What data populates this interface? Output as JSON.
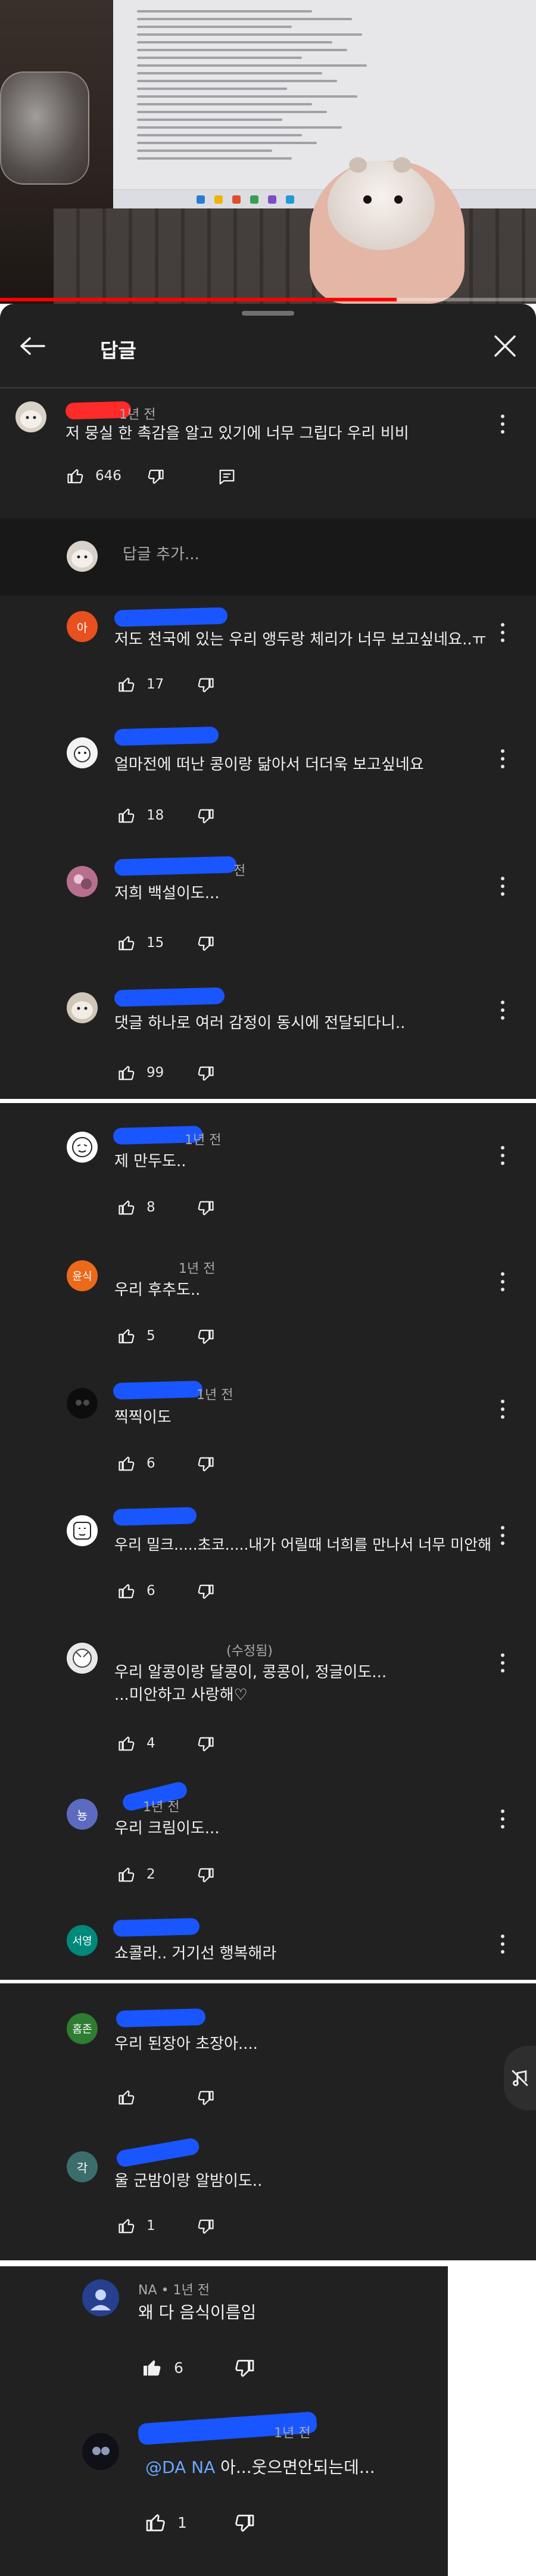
{
  "video": {
    "progress": 0.74
  },
  "sheet": {
    "title": "답글",
    "add_reply_placeholder": "답글 추가..."
  },
  "main_comment": {
    "meta": "1년 전",
    "text": "저 뭉실 한 촉감을 알고 있기에 너무 그립다 우리 비비",
    "likes": "646"
  },
  "replies": [
    {
      "avatar_letter": "아",
      "avatar_color": "#e8501f",
      "meta": "",
      "text": "저도 천국에 있는 우리 앵두랑 체리가 너무 보고싶네요..ㅠ",
      "likes": "17"
    },
    {
      "avatar_letter": "",
      "avatar_color": "#f3f3f3",
      "meta": "",
      "text": "얼마전에 떠난 콩이랑 닮아서 더더욱 보고싶네요",
      "likes": "18"
    },
    {
      "avatar_letter": "",
      "avatar_color": "#c98aa3",
      "meta": "전",
      "text": "저희 백설이도...",
      "likes": "15"
    },
    {
      "avatar_letter": "",
      "avatar_color": "#cfc6b8",
      "meta": "",
      "text": "댓글 하나로 여러 감정이 동시에 전달되다니..",
      "likes": "99"
    }
  ],
  "replies2": [
    {
      "avatar_letter": "",
      "avatar_color": "#ffffff",
      "meta": "1년 전",
      "lines": [
        "제 만두도.."
      ],
      "likes": "8"
    },
    {
      "avatar_letter": "윤식",
      "avatar_color": "#ea6a1a",
      "meta": "1년 전",
      "lines": [
        "우리 후추도.."
      ],
      "likes": "5"
    },
    {
      "avatar_letter": "",
      "avatar_color": "#111111",
      "meta": "1년 전",
      "lines": [
        "찍찍이도"
      ],
      "likes": "6"
    },
    {
      "avatar_letter": "",
      "avatar_color": "#ffffff",
      "meta": "",
      "lines": [
        "우리 밀크.....초코.....내가 어릴때 너희를 만나서 너무 미안해"
      ],
      "likes": "6"
    },
    {
      "avatar_letter": "",
      "avatar_color": "#e9e9e9",
      "meta": "(수정됨)",
      "lines": [
        "우리 알콩이랑 달콩이, 콩콩이, 정글이도...",
        "...미안하고 사랑해♡"
      ],
      "likes": "4"
    },
    {
      "avatar_letter": "뇽",
      "avatar_color": "#5c6bc0",
      "meta": "1년 전",
      "lines": [
        "우리 크림이도..."
      ],
      "likes": "2"
    },
    {
      "avatar_letter": "서영",
      "avatar_color": "#00897b",
      "meta": "",
      "lines": [
        "쇼콜라.. 거기선 행복해라"
      ],
      "likes": ""
    }
  ],
  "replies3": [
    {
      "avatar_letter": "홈존",
      "avatar_color": "#2e7d32",
      "meta": "",
      "text": "우리 된장아  초장아....",
      "likes": ""
    },
    {
      "avatar_letter": "각",
      "avatar_color": "#3b6e6a",
      "meta": "",
      "text": "울 군밤이랑 알밤이도..",
      "likes": "1"
    }
  ],
  "replies4": [
    {
      "meta": "NA • 1년 전",
      "mention": "",
      "text": "왜 다 음식이름임",
      "likes": "6"
    },
    {
      "meta": "1년 전",
      "mention": "@DA NA",
      "text": " 아...웃으면안되는데...",
      "likes": "1"
    }
  ]
}
